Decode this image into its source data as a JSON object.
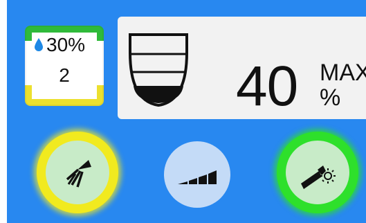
{
  "water": {
    "percent": "30%",
    "level": "2",
    "colors": {
      "top": "#2fba3a",
      "bottom": "#ece02e",
      "drop": "#1e88e5"
    }
  },
  "display": {
    "speed_value": "40",
    "max_label": "MAX",
    "unit_label": "%",
    "bowl_fill_fraction": 0.25
  },
  "buttons": [
    {
      "name": "spray-button",
      "icon": "spray-icon",
      "ring_color": "#f1ea1f"
    },
    {
      "name": "power-level-button",
      "icon": "power-bars-icon"
    },
    {
      "name": "light-button",
      "icon": "handpiece-light-icon",
      "ring_color": "#2ee02b"
    }
  ],
  "colors": {
    "background": "#2888f0",
    "card": "#f2f2f2"
  }
}
